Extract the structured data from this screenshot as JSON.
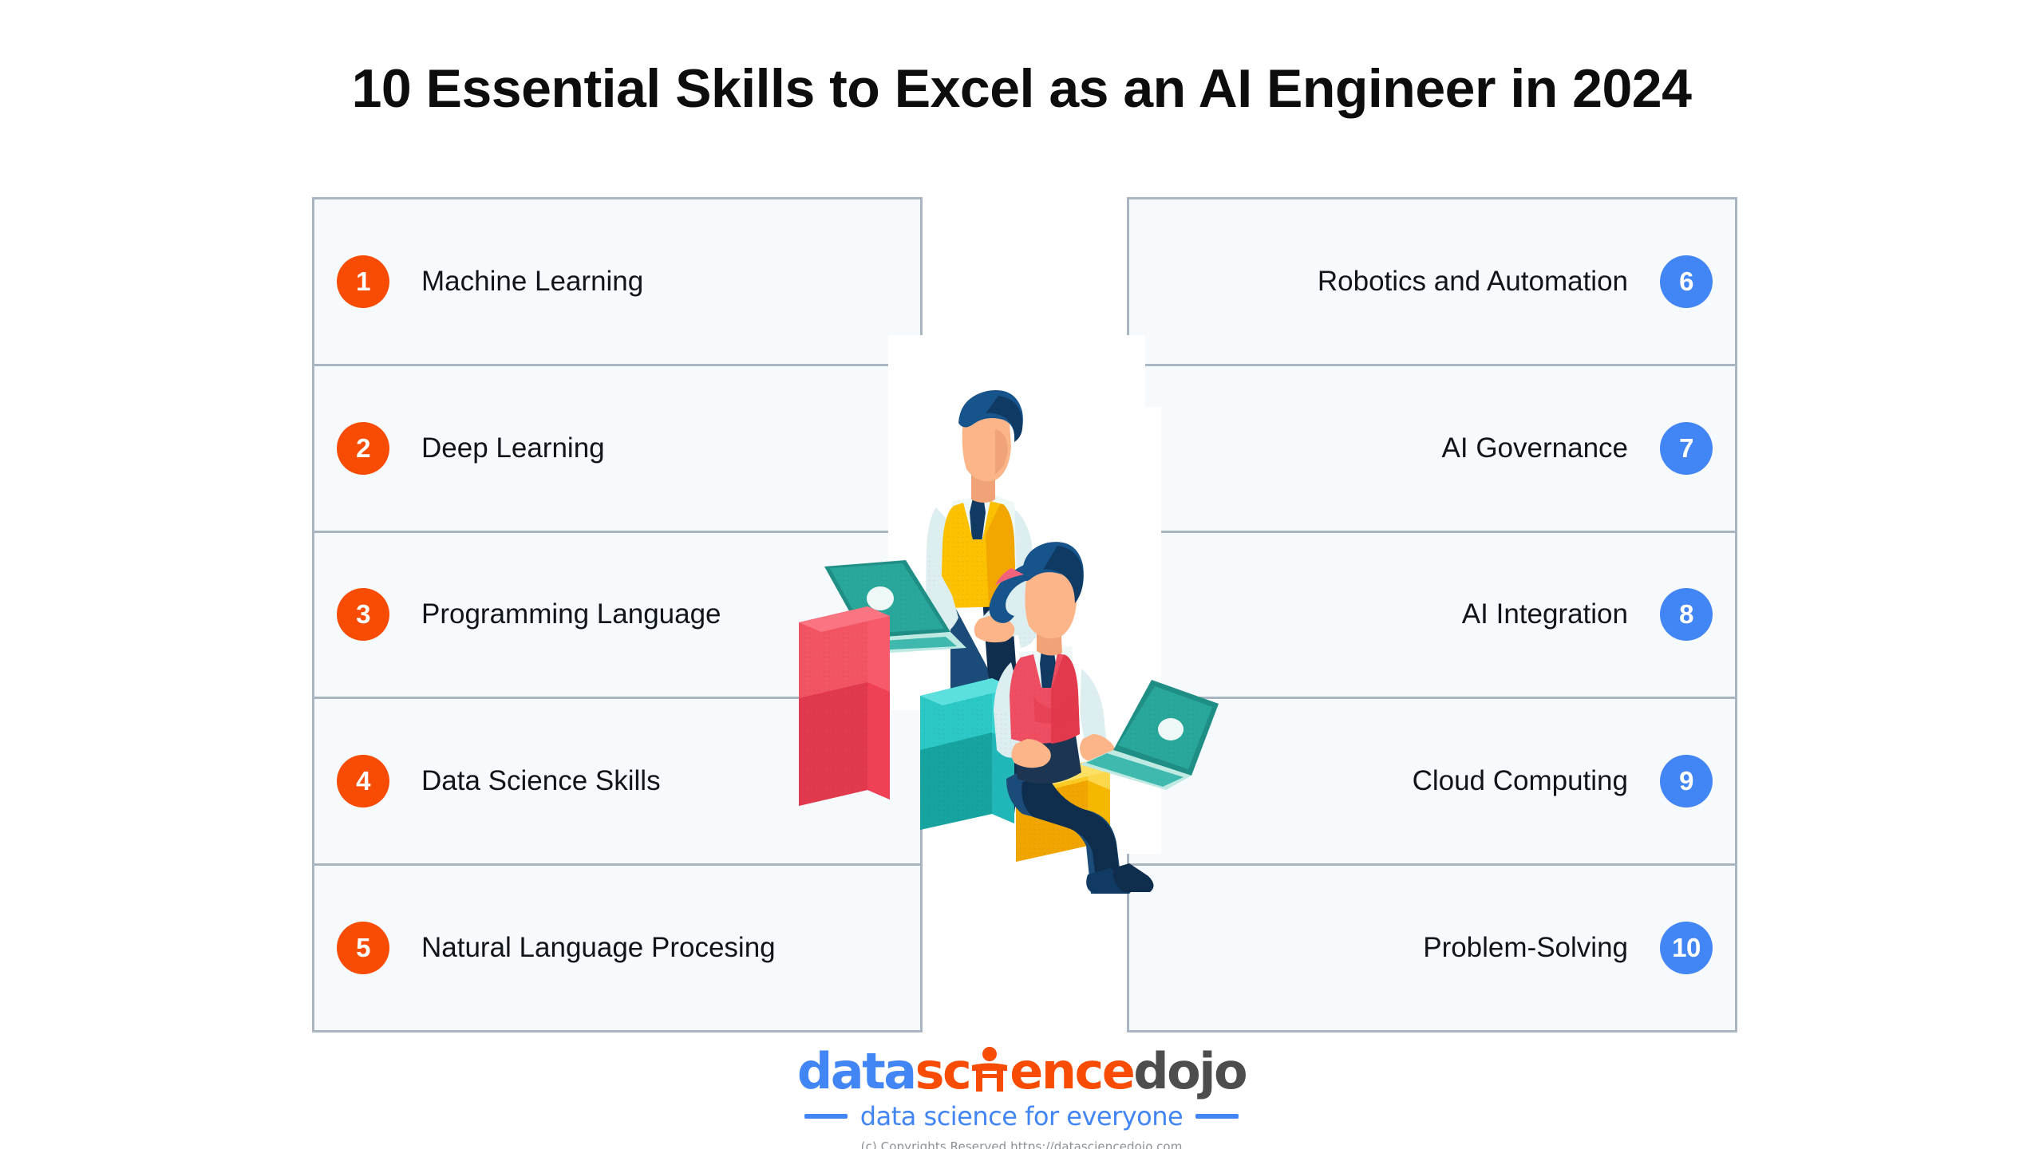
{
  "header": {
    "title": "10 Essential Skills to Excel as an AI Engineer in 2024"
  },
  "colors": {
    "badge_orange": "#f84c05",
    "badge_blue": "#4285f4",
    "card_border": "#a9b6c2",
    "card_fill": "#f6fafd",
    "title_text": "#0d0d0d",
    "bar_red": "#ef4056",
    "bar_teal": "#21b6b8",
    "bar_yellow": "#f5b700"
  },
  "skills": {
    "left_column": [
      {
        "number": "1",
        "label": "Machine Learning",
        "badge_color": "orange"
      },
      {
        "number": "2",
        "label": "Deep Learning",
        "badge_color": "orange"
      },
      {
        "number": "3",
        "label": "Programming Language",
        "badge_color": "orange"
      },
      {
        "number": "4",
        "label": "Data Science Skills",
        "badge_color": "orange"
      },
      {
        "number": "5",
        "label": "Natural Language Procesing",
        "badge_color": "orange"
      }
    ],
    "right_column": [
      {
        "number": "6",
        "label": "Robotics and Automation",
        "badge_color": "blue"
      },
      {
        "number": "7",
        "label": "AI Governance",
        "badge_color": "blue"
      },
      {
        "number": "8",
        "label": "AI Integration",
        "badge_color": "blue"
      },
      {
        "number": "9",
        "label": "Cloud Computing",
        "badge_color": "blue"
      },
      {
        "number": "10",
        "label": "Problem-Solving",
        "badge_color": "blue"
      }
    ]
  },
  "illustration": {
    "description": "two people working on laptops on 3D bar chart blocks",
    "bars": [
      {
        "name": "tall-red-bar",
        "color": "#ef4056"
      },
      {
        "name": "medium-teal-bar",
        "color": "#21b6b8"
      },
      {
        "name": "short-yellow-bar",
        "color": "#f5b700"
      }
    ]
  },
  "logo": {
    "part_data": "data",
    "part_sc": "sc",
    "part_ence": "ence",
    "part_dojo": "dojo",
    "tagline": "data science for everyone",
    "copyright": "(c) Copyrights Reserved  https://datasciencedojo.com"
  }
}
